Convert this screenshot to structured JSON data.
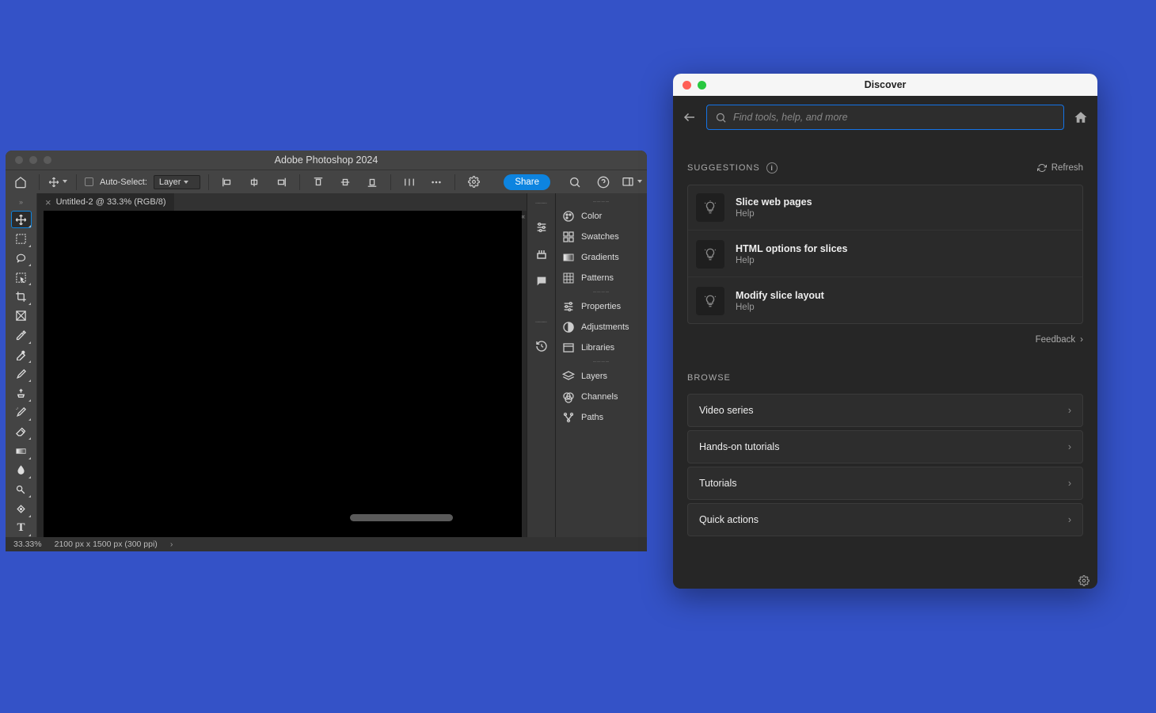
{
  "photoshop": {
    "title": "Adobe Photoshop 2024",
    "tab": "Untitled-2 @ 33.3% (RGB/8)",
    "options": {
      "auto_select_label": "Auto-Select:",
      "auto_select_target": "Layer",
      "share": "Share"
    },
    "right_panels": {
      "group1": [
        "Color",
        "Swatches",
        "Gradients",
        "Patterns"
      ],
      "group2": [
        "Properties",
        "Adjustments",
        "Libraries"
      ],
      "group3": [
        "Layers",
        "Channels",
        "Paths"
      ]
    },
    "status": {
      "zoom": "33.33%",
      "dims": "2100 px x 1500 px (300 ppi)"
    }
  },
  "discover": {
    "title": "Discover",
    "search_placeholder": "Find tools, help, and more",
    "suggestions_label": "SUGGESTIONS",
    "refresh_label": "Refresh",
    "suggestions": [
      {
        "title": "Slice web pages",
        "sub": "Help"
      },
      {
        "title": "HTML options for slices",
        "sub": "Help"
      },
      {
        "title": "Modify slice layout",
        "sub": "Help"
      }
    ],
    "feedback": "Feedback",
    "browse_label": "BROWSE",
    "browse": [
      "Video series",
      "Hands-on tutorials",
      "Tutorials",
      "Quick actions"
    ]
  }
}
